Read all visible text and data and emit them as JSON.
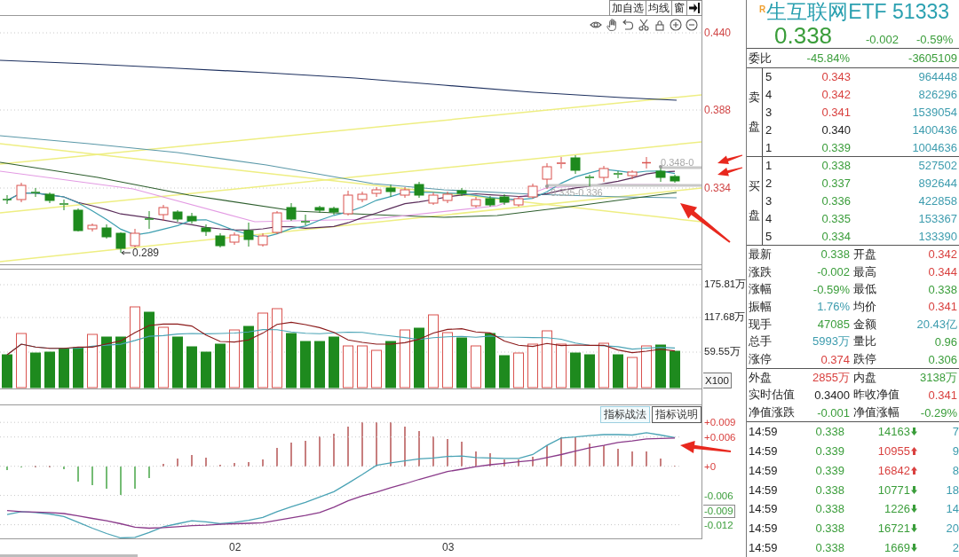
{
  "toolbar": {
    "buttons": [
      "加自选",
      "均线",
      "窗"
    ]
  },
  "price_pane": {
    "y_axis_labels": [
      "0.440",
      "0.388",
      "0.334"
    ],
    "low_label": "0.289",
    "range_labels": [
      "0.348-0",
      "0.335-0.336"
    ]
  },
  "volume_pane": {
    "y_axis_labels": [
      "175.81万",
      "117.68万",
      "59.55万"
    ],
    "scale_label": "X100"
  },
  "indicator_pane": {
    "buttons": [
      {
        "label": "指标战法",
        "selected": true
      },
      {
        "label": "指标说明",
        "selected": false
      }
    ],
    "signal_lines": {
      "chart_data": {
        "type": "line",
        "categories": [
          null,
          null,
          null,
          null,
          null,
          null,
          null,
          null,
          null,
          null,
          null,
          null,
          null,
          null,
          null,
          null,
          "02",
          null,
          null,
          null,
          null,
          null,
          null,
          null,
          null,
          null,
          null,
          null,
          null,
          null,
          null,
          "03",
          null,
          null,
          null,
          null,
          null,
          null,
          null,
          null,
          null,
          null,
          null,
          null,
          null,
          null,
          null,
          null
        ],
        "ylim": [
          -0.0148,
          0.0125
        ],
        "yticks": [
          {
            "value": 0.009,
            "label": "+0.009"
          },
          {
            "value": 0.006,
            "label": "+0.006"
          },
          {
            "value": 0,
            "label": "+0"
          },
          {
            "value": -0.006,
            "label": "-0.006"
          },
          {
            "value": -0.012,
            "label": "-0.012"
          }
        ],
        "grid": true,
        "series": [
          {
            "color": "#4aa3b5",
            "values": [
              -0.0099,
              -0.0093,
              -0.0095,
              -0.0098,
              -0.0103,
              -0.0115,
              -0.0127,
              -0.0138,
              -0.0147,
              -0.0146,
              -0.0136,
              -0.0124,
              -0.0118,
              -0.0112,
              -0.0114,
              -0.0118,
              -0.0115,
              -0.0111,
              -0.0105,
              -0.0093,
              -0.0083,
              -0.0074,
              -0.0063,
              -0.0052,
              -0.0035,
              -0.0017,
              0.0002,
              0.0007,
              0.0011,
              0.0015,
              0.0017,
              0.002,
              0.0021,
              0.0018,
              0.0017,
              0.0016,
              0.0016,
              0.0024,
              0.0043,
              0.0058,
              0.006,
              0.0063,
              0.0065,
              0.0065,
              0.0064,
              0.0069,
              0.0064,
              0.0059
            ]
          },
          {
            "color": "#8a3a8a",
            "values": [
              -0.0091,
              -0.0093,
              -0.0094,
              -0.0095,
              -0.0097,
              -0.0102,
              -0.0107,
              -0.0112,
              -0.0118,
              -0.0125,
              -0.0127,
              -0.0126,
              -0.0124,
              -0.0122,
              -0.0121,
              -0.0119,
              -0.0118,
              -0.0117,
              -0.0116,
              -0.0111,
              -0.0106,
              -0.0101,
              -0.0095,
              -0.0084,
              -0.0071,
              -0.0061,
              -0.0053,
              -0.0044,
              -0.0036,
              -0.0027,
              -0.0019,
              -0.0011,
              -0.0006,
              -0.0001,
              0.0003,
              0.0006,
              0.0009,
              0.0012,
              0.0018,
              0.0024,
              0.0031,
              0.0038,
              0.0043,
              0.0049,
              0.0052,
              0.0056,
              0.0057,
              0.0058
            ]
          }
        ]
      }
    },
    "value_marker": "-0.009"
  },
  "quote": {
    "tag": "R",
    "title": "生互联网ETF 51333",
    "price": "0.338",
    "change": "-0.002",
    "change_percent": "-0.59%",
    "color": "#3a9d3a"
  },
  "order_ratio": {
    "label": "委比",
    "percent": "-45.84%",
    "difference": "-3605109",
    "color": "#3a9d3a"
  },
  "asks": {
    "label": "卖盘",
    "rows": [
      {
        "rank": "5",
        "price": "0.343",
        "color": "#d9413f",
        "volume": "964448"
      },
      {
        "rank": "4",
        "price": "0.342",
        "color": "#d9413f",
        "volume": "826296"
      },
      {
        "rank": "3",
        "price": "0.341",
        "color": "#d9413f",
        "volume": "1539054"
      },
      {
        "rank": "2",
        "price": "0.340",
        "color": "#222222",
        "volume": "1400436"
      },
      {
        "rank": "1",
        "price": "0.339",
        "color": "#3a9d3a",
        "volume": "1004636"
      }
    ]
  },
  "bids": {
    "label": "买盘",
    "rows": [
      {
        "rank": "1",
        "price": "0.338",
        "color": "#3a9d3a",
        "volume": "527502"
      },
      {
        "rank": "2",
        "price": "0.337",
        "color": "#3a9d3a",
        "volume": "892644"
      },
      {
        "rank": "3",
        "price": "0.336",
        "color": "#3a9d3a",
        "volume": "422858"
      },
      {
        "rank": "4",
        "price": "0.335",
        "color": "#3a9d3a",
        "volume": "153367"
      },
      {
        "rank": "5",
        "price": "0.334",
        "color": "#3a9d3a",
        "volume": "133390"
      }
    ]
  },
  "stats": [
    {
      "label": "最新",
      "value": "0.338",
      "color": "#3a9d3a"
    },
    {
      "label": "开盘",
      "value": "0.342",
      "color": "#d9413f"
    },
    {
      "label": "涨跌",
      "value": "-0.002",
      "color": "#3a9d3a"
    },
    {
      "label": "最高",
      "value": "0.344",
      "color": "#d9413f"
    },
    {
      "label": "涨幅",
      "value": "-0.59%",
      "color": "#3a9d3a"
    },
    {
      "label": "最低",
      "value": "0.338",
      "color": "#3a9d3a"
    },
    {
      "label": "振幅",
      "value": "1.76%",
      "color": "#3d9cae"
    },
    {
      "label": "均价",
      "value": "0.341",
      "color": "#d9413f"
    },
    {
      "label": "现手",
      "value": "47085",
      "color": "#3a9d3a"
    },
    {
      "label": "金额",
      "value": "20.43亿",
      "color": "#3d9cae"
    },
    {
      "label": "总手",
      "value": "5993万",
      "color": "#3d9cae"
    },
    {
      "label": "量比",
      "value": "0.96",
      "color": "#3a9d3a"
    },
    {
      "label": "涨停",
      "value": "0.374",
      "color": "#d9413f"
    },
    {
      "label": "跌停",
      "value": "0.306",
      "color": "#3a9d3a"
    }
  ],
  "fund_stats": [
    {
      "label": "外盘",
      "value": "2855万",
      "color": "#d9413f"
    },
    {
      "label": "内盘",
      "value": "3138万",
      "color": "#3a9d3a"
    },
    {
      "label": "实时估值",
      "value": "0.3400",
      "color": "#222222"
    },
    {
      "label": "昨收净值",
      "value": "0.341",
      "color": "#d9413f"
    },
    {
      "label": "净值涨跌",
      "value": "-0.001",
      "color": "#3a9d3a"
    },
    {
      "label": "净值涨幅",
      "value": "-0.29%",
      "color": "#3a9d3a"
    }
  ],
  "trades": [
    {
      "time": "14:59",
      "price": "0.338",
      "color": "#3a9d3a",
      "volume": "14163",
      "up": false,
      "column_4": "7"
    },
    {
      "time": "14:59",
      "price": "0.339",
      "color": "#3a9d3a",
      "volume": "10955",
      "up": true,
      "column_4": "9"
    },
    {
      "time": "14:59",
      "price": "0.339",
      "color": "#3a9d3a",
      "volume": "16842",
      "up": true,
      "column_4": "8"
    },
    {
      "time": "14:59",
      "price": "0.338",
      "color": "#3a9d3a",
      "volume": "10771",
      "up": false,
      "column_4": "18"
    },
    {
      "time": "14:59",
      "price": "0.338",
      "color": "#3a9d3a",
      "volume": "1226",
      "up": false,
      "column_4": "14"
    },
    {
      "time": "14:59",
      "price": "0.338",
      "color": "#3a9d3a",
      "volume": "16721",
      "up": false,
      "column_4": "20"
    },
    {
      "time": "14:59",
      "price": "0.338",
      "color": "#3a9d3a",
      "volume": "1669",
      "up": false,
      "column_4": "2"
    }
  ]
}
